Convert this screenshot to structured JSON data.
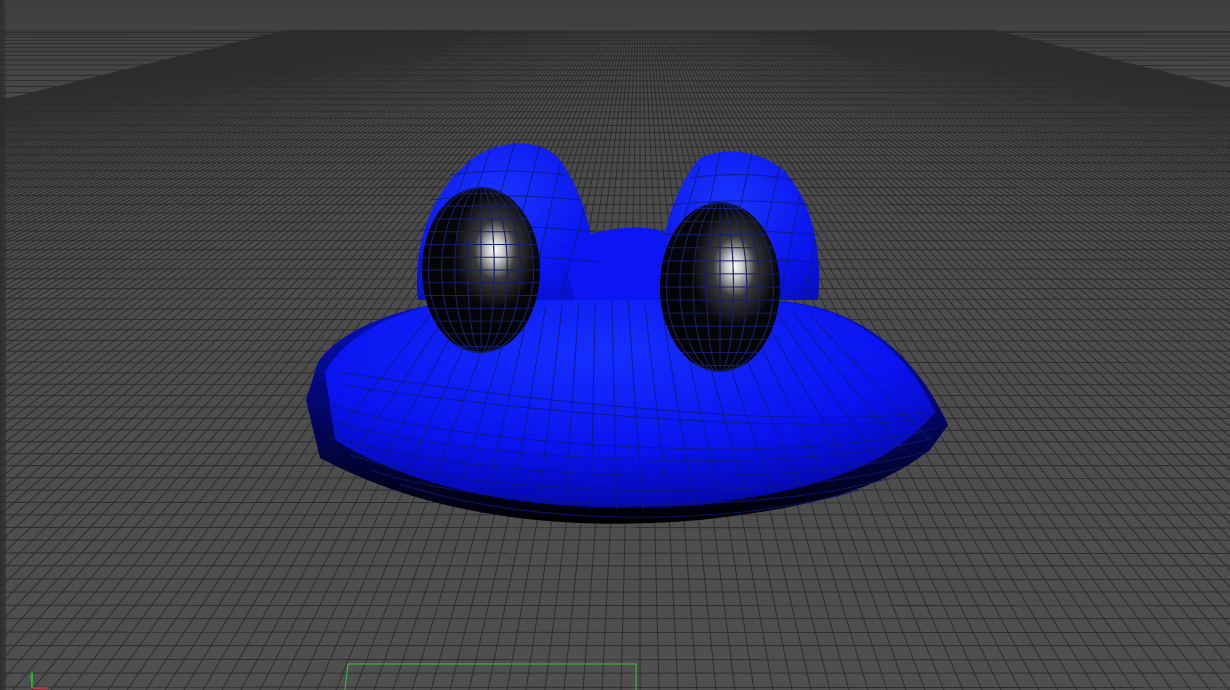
{
  "app": {
    "view": "perspective-viewport",
    "shading": "smooth-shade-wireframe-on-shaded"
  },
  "scene": {
    "object": {
      "name": "frog-head-mesh",
      "material_color": "#0a12f5",
      "wire_color": "#0c1a78",
      "eye_color": "#000000"
    },
    "grid_color": "#2c2c2c"
  },
  "axis_gizmo": {
    "icon": "xyz-axis-icon",
    "y_color": "#29c229",
    "x_color": "#d43a3a"
  }
}
